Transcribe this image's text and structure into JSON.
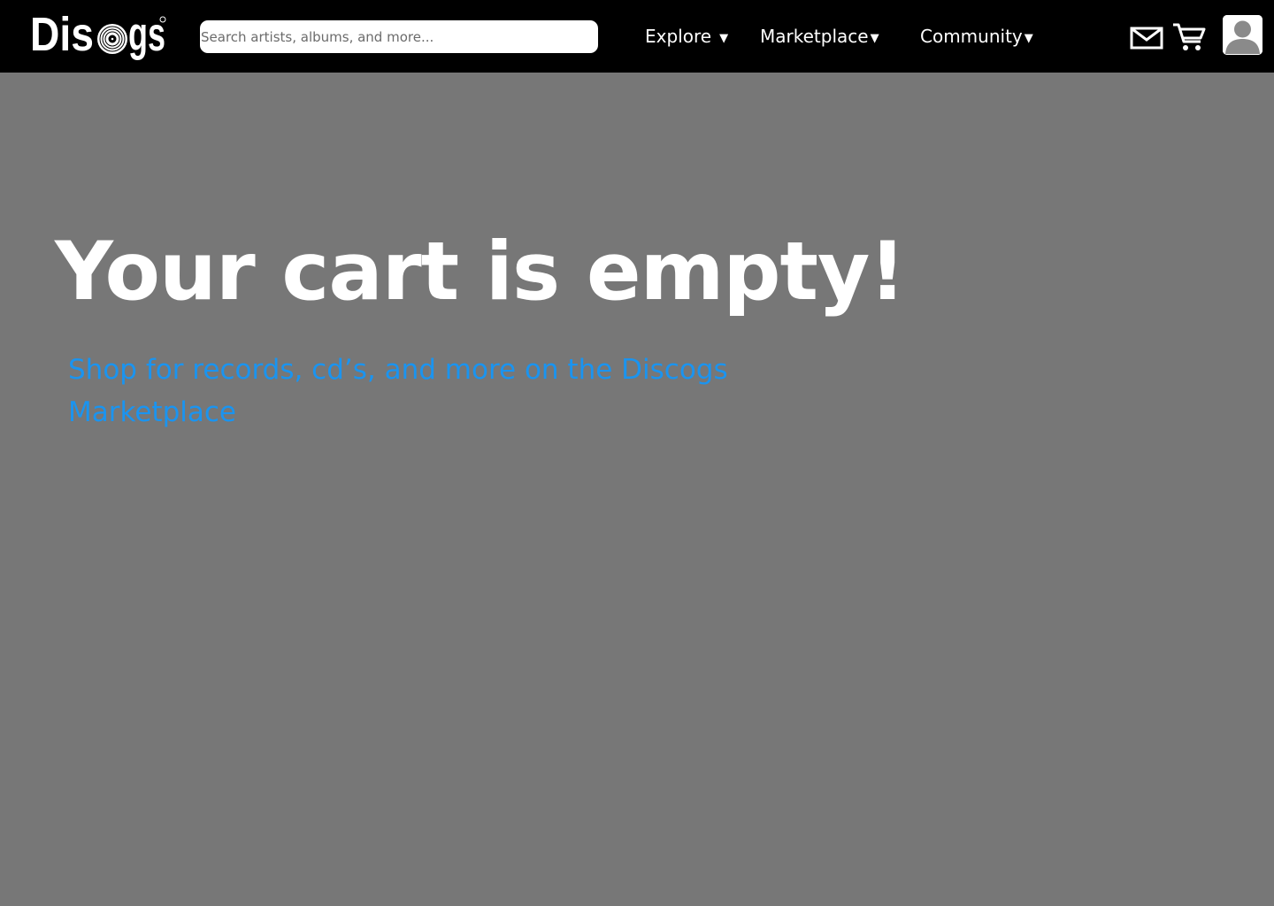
{
  "header": {
    "logo_text": "Discogs",
    "search": {
      "placeholder": "Search artists, albums, and more...",
      "value": ""
    },
    "nav": [
      {
        "label": "Explore",
        "caret": "▼"
      },
      {
        "label": "Marketplace",
        "caret": "▼"
      },
      {
        "label": "Community",
        "caret": "▼"
      }
    ],
    "icons": {
      "mail": "mail-icon",
      "cart": "cart-icon",
      "avatar": "user-avatar-icon"
    }
  },
  "main": {
    "heading": "Your cart is empty!",
    "link_line1": "Shop for records, cd’s, and more on the Discogs",
    "link_line2": "Marketplace"
  },
  "colors": {
    "header_bg": "#000000",
    "page_bg": "#777777",
    "link": "#1a94f0",
    "text": "#ffffff"
  }
}
